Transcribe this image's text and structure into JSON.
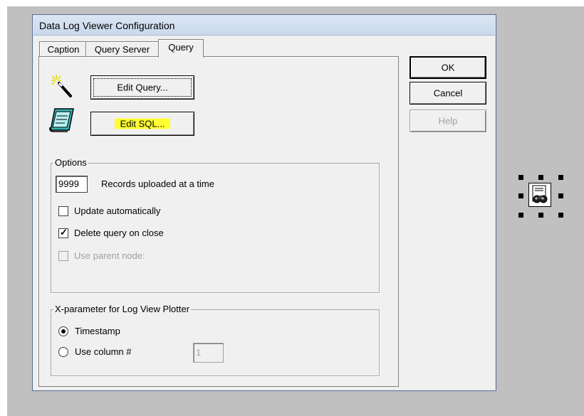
{
  "dialog": {
    "title": "Data Log Viewer Configuration",
    "tabs": [
      {
        "label": "Caption"
      },
      {
        "label": "Query Server"
      },
      {
        "label": "Query"
      }
    ],
    "active_tab": "Query"
  },
  "query_tab": {
    "edit_query_label": "Edit Query...",
    "edit_sql_label": "Edit SQL...",
    "highlight_color": "#ffff33",
    "options": {
      "legend": "Options",
      "records_value": "9999",
      "records_label": "Records uploaded at a time",
      "update_auto_label": "Update automatically",
      "update_auto_checked": false,
      "delete_query_label": "Delete query on close",
      "delete_query_checked": true,
      "use_parent_label": "Use parent node:",
      "use_parent_enabled": false
    },
    "xparam": {
      "legend": "X-parameter for Log View Plotter",
      "timestamp_label": "Timestamp",
      "use_column_label": "Use column #",
      "selected": "Timestamp",
      "column_value": "1"
    }
  },
  "buttons": {
    "ok": "OK",
    "cancel": "Cancel",
    "help": "Help"
  },
  "icons": {
    "wand": "magic-wand-icon",
    "notepad": "notepad-icon",
    "object": "data-log-viewer-object-icon"
  }
}
